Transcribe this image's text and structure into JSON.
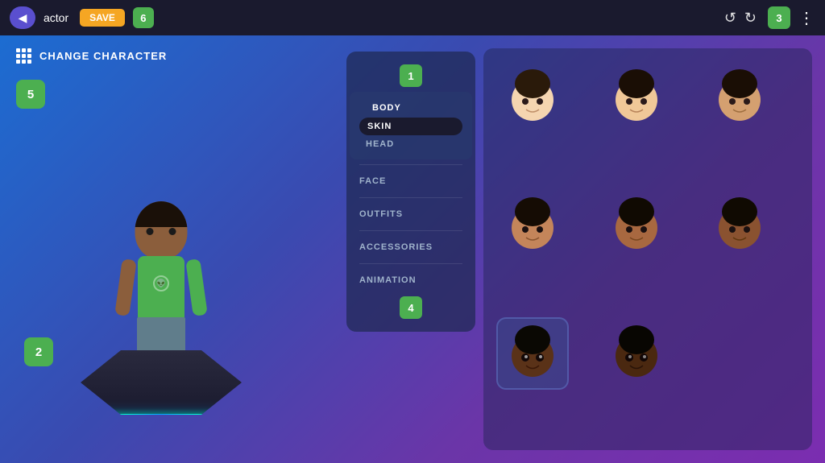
{
  "app": {
    "title": "actor",
    "save_label": "SAVE"
  },
  "topbar": {
    "back_label": "←",
    "undo_label": "↺",
    "redo_label": "↻",
    "more_label": "⋮",
    "badge_6": "6",
    "badge_3": "3"
  },
  "character_panel": {
    "title": "CHANGE CHARACTER",
    "badge_5": "5",
    "badge_2": "2"
  },
  "menu": {
    "badge_1": "1",
    "body_label": "BODY",
    "skin_label": "SKIN",
    "head_label": "HEAD",
    "face_label": "FACE",
    "outfits_label": "OUTFITS",
    "accessories_label": "ACCESSORIES",
    "animation_label": "ANIMATION",
    "badge_4": "4"
  },
  "avatars": [
    {
      "id": 1,
      "skin": "light",
      "selected": false
    },
    {
      "id": 2,
      "skin": "light-medium",
      "selected": false
    },
    {
      "id": 3,
      "skin": "light-dark",
      "selected": false
    },
    {
      "id": 4,
      "skin": "medium",
      "selected": false
    },
    {
      "id": 5,
      "skin": "medium-dark",
      "selected": false
    },
    {
      "id": 6,
      "skin": "dark",
      "selected": false
    },
    {
      "id": 7,
      "skin": "darkest",
      "selected": true
    },
    {
      "id": 8,
      "skin": "darkest2",
      "selected": false
    }
  ],
  "colors": {
    "accent_green": "#4caf50",
    "topbar_bg": "#1a1a2e",
    "save_orange": "#f5a623",
    "menu_bg": "rgba(30,40,80,0.7)",
    "grid_bg": "rgba(30,35,80,0.45)"
  }
}
